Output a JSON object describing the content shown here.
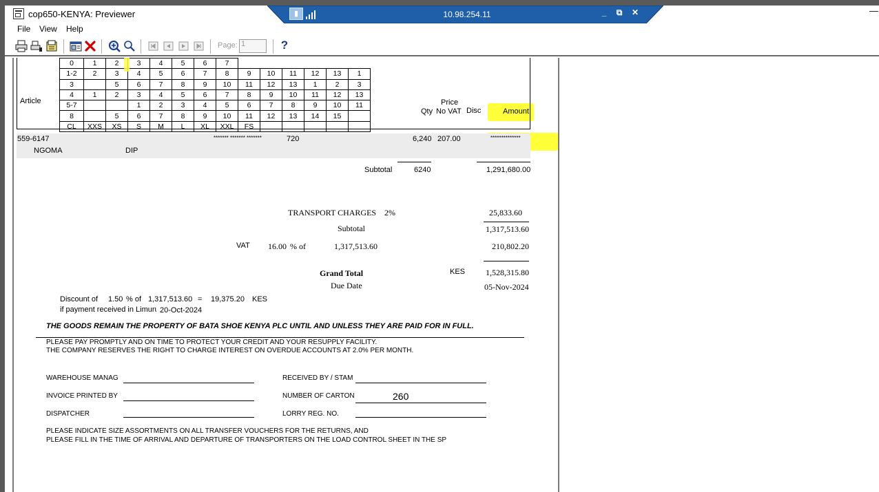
{
  "window": {
    "title": "cop650-KENYA: Previewer",
    "minimize_glyph": "—"
  },
  "rdp": {
    "address": "10.98.254.11",
    "minimize": "_",
    "restore": "⧉",
    "close": "✕",
    "color": "#1f5ea8"
  },
  "menu": {
    "file": "File",
    "view": "View",
    "help": "Help"
  },
  "toolbar": {
    "page_label": "Page:",
    "page_value": "1",
    "help_label": "?",
    "icons": [
      "print-icon",
      "print-setup-icon",
      "export-icon",
      "layout-icon",
      "close-icon",
      "zoom-in-icon",
      "zoom-out-icon",
      "first-page-icon",
      "previous-page-icon",
      "next-page-icon",
      "last-page-icon",
      "help-icon"
    ]
  },
  "size_grid": {
    "rows": [
      [
        "0",
        "1",
        "2",
        "3",
        "4",
        "5",
        "6",
        "7",
        "",
        "",
        "",
        "",
        ""
      ],
      [
        "1-2",
        "2",
        "3",
        "4",
        "5",
        "6",
        "7",
        "8",
        "9",
        "10",
        "11",
        "12",
        "13",
        "1"
      ],
      [
        "3",
        "",
        "5",
        "6",
        "7",
        "8",
        "9",
        "10",
        "11",
        "12",
        "13",
        "1",
        "2",
        "3"
      ],
      [
        "4",
        "1",
        "2",
        "3",
        "4",
        "5",
        "6",
        "7",
        "8",
        "9",
        "10",
        "11",
        "12",
        "13"
      ],
      [
        "5-7",
        "",
        "",
        "1",
        "2",
        "3",
        "4",
        "5",
        "6",
        "7",
        "8",
        "9",
        "10",
        "11"
      ],
      [
        "8",
        "",
        "5",
        "6",
        "7",
        "8",
        "9",
        "10",
        "11",
        "12",
        "13",
        "14",
        "15",
        ""
      ],
      [
        "CL",
        "XXS",
        "XS",
        "S",
        "M",
        "L",
        "XL",
        "XXL",
        "FS",
        "",
        "",
        "",
        "",
        ""
      ]
    ]
  },
  "header": {
    "article": "Article",
    "price": "Price",
    "qty": "Qty",
    "no_vat": "No VAT",
    "disc": "Disc",
    "amount": "Amount"
  },
  "line_item": {
    "article_code": "559-6147",
    "stars_group": "******* ******* *******",
    "size_count": "720",
    "qty": "6,240",
    "price": "207.00",
    "amount_masked": "**************",
    "name": "NGOMA",
    "variant": "DIP"
  },
  "subtotal1": {
    "label": "Subtotal",
    "qty": "6240",
    "amount": "1,291,680.00"
  },
  "transport": {
    "label": "TRANSPORT CHARGES",
    "pct": "2%",
    "amount": "25,833.60"
  },
  "subtotal2": {
    "label": "Subtotal",
    "amount": "1,317,513.60"
  },
  "vat": {
    "label": "VAT",
    "rate": "16.00",
    "pct_of": "% of",
    "base": "1,317,513.60",
    "amount": "210,802.20"
  },
  "grand_total": {
    "label": "Grand Total",
    "currency": "KES",
    "amount": "1,528,315.80"
  },
  "due_date": {
    "label": "Due Date",
    "value": "05-Nov-2024"
  },
  "discount": {
    "line1_prefix": "Discount of",
    "rate": "1.50",
    "pct_of": "% of",
    "base": "1,317,513.60",
    "equals": "=",
    "amount": "19,375.20",
    "currency": "KES",
    "line2_prefix": "if payment received in Limuru",
    "date": "20-Oct-2024"
  },
  "notices": {
    "property": "THE GOODS REMAIN THE PROPERTY OF BATA SHOE KENYA PLC UNTIL AND UNLESS THEY ARE PAID FOR IN FULL.",
    "pay_line1": "PLEASE PAY PROMPTLY AND ON TIME TO PROTECT YOUR CREDIT AND YOUR RESUPPLY FACILITY.",
    "pay_line2": "THE COMPANY RESERVES THE RIGHT TO CHARGE INTEREST ON OVERDUE ACCOUNTS AT 2.0% PER MONTH.",
    "footer_line1": "PLEASE INDICATE SIZE ASSORTMENTS ON ALL TRANSFER VOUCHERS FOR THE RETURNS, AND",
    "footer_line2": "PLEASE FILL IN THE TIME OF ARRIVAL AND DEPARTURE OF TRANSPORTERS ON THE LOAD CONTROL SHEET IN THE SP"
  },
  "signatures": {
    "warehouse": "WAREHOUSE MANAG",
    "printed_by": "INVOICE PRINTED BY",
    "dispatcher": "DISPATCHER",
    "received_by": "RECEIVED BY / STAM",
    "cartons_label": "NUMBER OF CARTON",
    "cartons_value": "260",
    "lorry": "LORRY REG. NO."
  },
  "colors": {
    "highlight": "#ffff3a",
    "row_shade": "#ececec"
  }
}
